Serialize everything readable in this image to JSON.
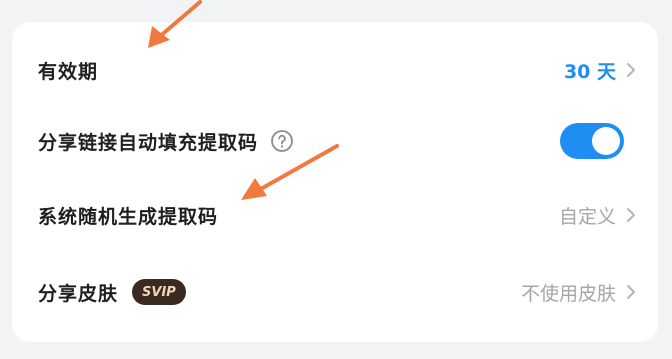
{
  "settings": {
    "rows": [
      {
        "label": "有效期",
        "value": "30 天"
      },
      {
        "label": "分享链接自动填充提取码",
        "toggle_on": true
      },
      {
        "label": "系统随机生成提取码",
        "value": "自定义"
      },
      {
        "label": "分享皮肤",
        "badge": "SVIP",
        "value": "不使用皮肤"
      }
    ]
  },
  "colors": {
    "accent": "#1e8ef2",
    "annotation_arrow": "#f07a3e",
    "svip_badge_bg": "#3a2a22"
  },
  "icons": {
    "help": "question-circle-icon",
    "chevron": "chevron-right-icon"
  }
}
